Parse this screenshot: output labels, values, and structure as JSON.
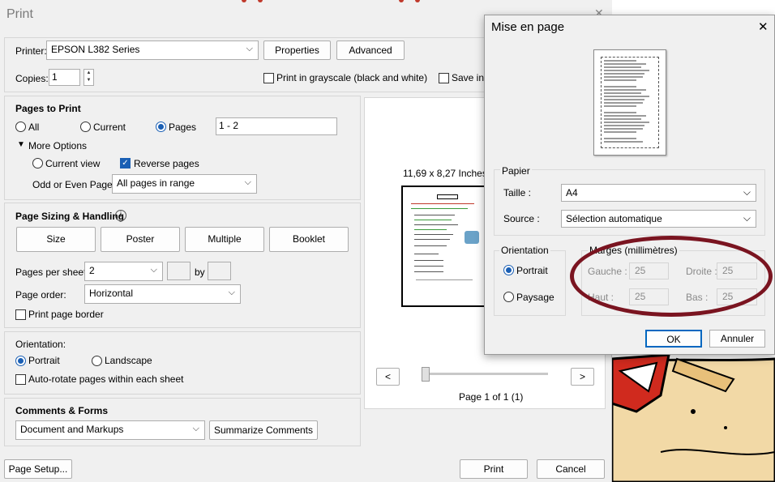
{
  "print_dialog": {
    "title": "Print",
    "printer_label": "Printer:",
    "printer_value": "EPSON L382 Series",
    "properties_button": "Properties",
    "advanced_button": "Advanced",
    "copies_label": "Copies:",
    "copies_value": "1",
    "grayscale_label": "Print in grayscale (black and white)",
    "save_ink_label": "Save ink",
    "pages_to_print": {
      "title": "Pages to Print",
      "all": "All",
      "current": "Current",
      "pages": "Pages",
      "pages_value": "1 - 2",
      "more_options": "More Options",
      "current_view": "Current view",
      "reverse_pages": "Reverse pages",
      "odd_even_label": "Odd or Even Pages:",
      "odd_even_value": "All pages in range"
    },
    "sizing": {
      "title": "Page Sizing & Handling",
      "size": "Size",
      "poster": "Poster",
      "multiple": "Multiple",
      "booklet": "Booklet",
      "pages_per_sheet_label": "Pages per sheet:",
      "pages_per_sheet_value": "2",
      "by_label": "by",
      "page_order_label": "Page order:",
      "page_order_value": "Horizontal",
      "print_border": "Print page border"
    },
    "orientation": {
      "title": "Orientation:",
      "portrait": "Portrait",
      "landscape": "Landscape",
      "auto_rotate": "Auto-rotate pages within each sheet"
    },
    "comments": {
      "title": "Comments & Forms",
      "value": "Document and Markups",
      "summarize": "Summarize Comments"
    },
    "preview": {
      "dimensions": "11,69 x 8,27 Inches",
      "page_indicator": "Page 1 of 1 (1)",
      "prev": "<",
      "next": ">",
      "slider_level": 0
    },
    "page_setup_button": "Page Setup...",
    "print_button": "Print",
    "cancel_button": "Cancel"
  },
  "mise_en_page": {
    "title": "Mise en page",
    "papier": {
      "title": "Papier",
      "taille_label": "Taille :",
      "taille_value": "A4",
      "source_label": "Source :",
      "source_value": "Sélection automatique"
    },
    "orientation": {
      "title": "Orientation",
      "portrait": "Portrait",
      "paysage": "Paysage"
    },
    "marges": {
      "title": "Marges (millimètres)",
      "gauche_label": "Gauche :",
      "gauche_value": "25",
      "droite_label": "Droite :",
      "droite_value": "25",
      "haut_label": "Haut :",
      "haut_value": "25",
      "bas_label": "Bas :",
      "bas_value": "25"
    },
    "ok_button": "OK",
    "cancel_button": "Annuler"
  },
  "colors": {
    "accent": "#1a5fb4",
    "highlight": "#7a1420"
  }
}
